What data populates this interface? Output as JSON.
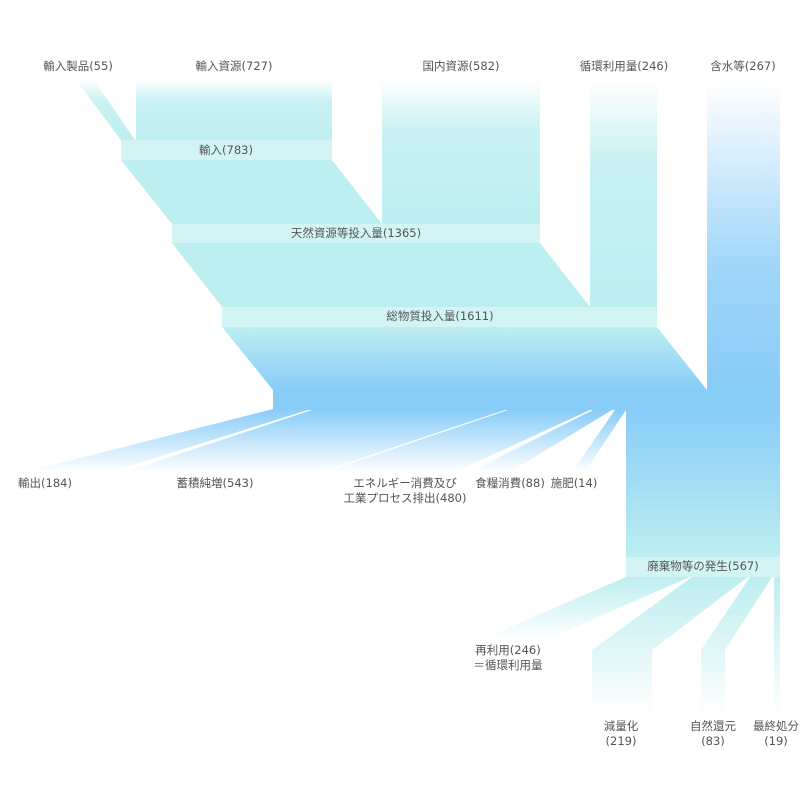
{
  "colors": {
    "cyan": "#c4f0f2",
    "cyan_node": "#d2f4f4",
    "blue": "#88ccf8",
    "text": "#555555"
  },
  "inputs": {
    "imported_products": "輸入製品(55)",
    "imported_resources": "輸入資源(727)",
    "domestic_resources": "国内資源(582)",
    "recycled_amount": "循環利用量(246)",
    "water_content": "含水等(267)"
  },
  "nodes": {
    "imports": "輸入(783)",
    "natural_resources_input": "天然資源等投入量(1365)",
    "total_material_input": "総物質投入量(1611)",
    "waste_generation": "廃棄物等の発生(567)"
  },
  "outputs": {
    "exports": "輸出(184)",
    "net_stock_addition": "蓄積純増(543)",
    "energy_line1": "エネルギー消費及び",
    "energy_line2": "工業プロセス排出(480)",
    "food_consumption": "食糧消費(88)",
    "fertilizer": "施肥(14)"
  },
  "waste_outputs": {
    "reuse_line1": "再利用(246)",
    "reuse_line2": "＝循環利用量",
    "reduction_line1": "減量化",
    "reduction_line2": "(219)",
    "natural_return_line1": "自然還元",
    "natural_return_line2": "(83)",
    "final_disposal_line1": "最終処分",
    "final_disposal_line2": "(19)"
  }
}
